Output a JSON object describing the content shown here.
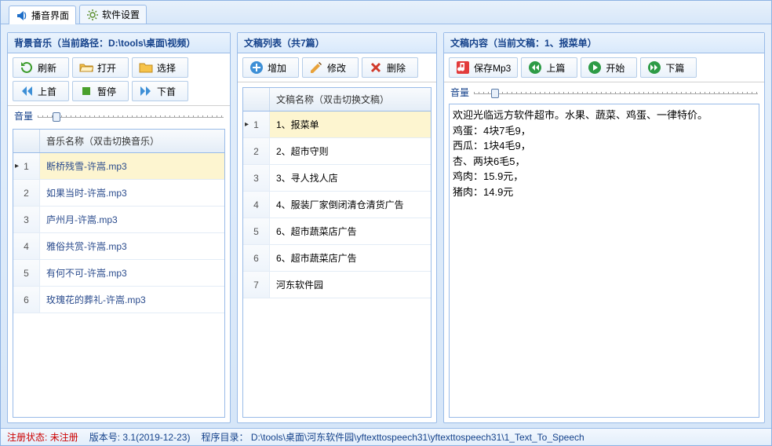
{
  "tabs": [
    {
      "label": "播音界面",
      "icon": "megaphone"
    },
    {
      "label": "软件设置",
      "icon": "gear"
    }
  ],
  "left": {
    "title": "背景音乐（当前路径：D:\\tools\\桌面\\视频）",
    "buttons": {
      "refresh": "刷新",
      "open": "打开",
      "select": "选择",
      "prev": "上首",
      "pause": "暂停",
      "next": "下首"
    },
    "volume_label": "音量",
    "volume_percent": 8,
    "grid_header": "音乐名称（双击切换音乐）",
    "rows": [
      {
        "n": "1",
        "name": "断桥残雪-许嵩.mp3",
        "sel": true
      },
      {
        "n": "2",
        "name": "如果当时-许嵩.mp3"
      },
      {
        "n": "3",
        "name": "庐州月-许嵩.mp3"
      },
      {
        "n": "4",
        "name": "雅俗共赏-许嵩.mp3"
      },
      {
        "n": "5",
        "name": "有何不可-许嵩.mp3"
      },
      {
        "n": "6",
        "name": "玫瑰花的葬礼-许嵩.mp3"
      }
    ]
  },
  "mid": {
    "title": "文稿列表（共7篇）",
    "buttons": {
      "add": "增加",
      "edit": "修改",
      "delete": "删除"
    },
    "grid_header": "文稿名称（双击切换文稿）",
    "rows": [
      {
        "n": "1",
        "name": "1、报菜单",
        "sel": true
      },
      {
        "n": "2",
        "name": "2、超市守则"
      },
      {
        "n": "3",
        "name": "3、寻人找人店"
      },
      {
        "n": "4",
        "name": "4、服装厂家倒闭清仓清货广告"
      },
      {
        "n": "5",
        "name": "6、超市蔬菜店广告"
      },
      {
        "n": "6",
        "name": "6、超市蔬菜店广告"
      },
      {
        "n": "7",
        "name": "河东软件园"
      }
    ]
  },
  "right": {
    "title": "文稿内容（当前文稿：1、报菜单）",
    "buttons": {
      "save": "保存Mp3",
      "prev": "上篇",
      "start": "开始",
      "next": "下篇"
    },
    "volume_label": "音量",
    "volume_percent": 6,
    "text": "欢迎光临远方软件超市。水果、蔬菜、鸡蛋、一律特价。\n鸡蛋：4块7毛9，\n西瓜：1块4毛9，\n杏、两块6毛5，\n鸡肉：15.9元，\n猪肉：14.9元"
  },
  "status": {
    "reg_label": "注册状态:",
    "reg_value": "未注册",
    "version_label": "版本号:",
    "version_value": "3.1(2019-12-23)",
    "dir_label": "程序目录：",
    "dir_value": "D:\\tools\\桌面\\河东软件园\\yftexttospeech31\\yftexttospeech31\\1_Text_To_Speech"
  }
}
